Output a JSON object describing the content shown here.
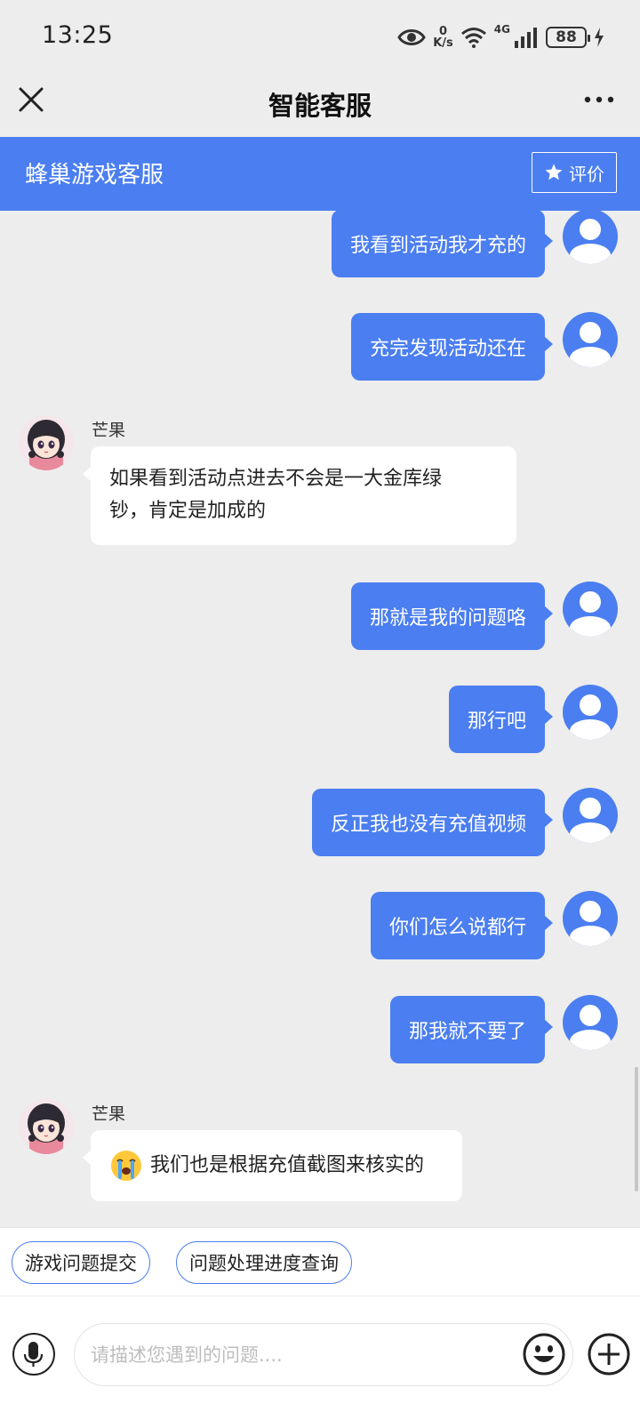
{
  "status_bar": {
    "time": "13:25",
    "net_speed_value": "0",
    "net_speed_unit": "K/s",
    "signal_type": "4G",
    "battery": "88"
  },
  "header": {
    "title": "智能客服",
    "close_icon": "close-icon",
    "more_icon": "more-icon"
  },
  "service_bar": {
    "name": "蜂巢游戏客服",
    "rate_label": "评价",
    "rate_icon": "star-icon"
  },
  "messages": [
    {
      "side": "right",
      "text": "我看到活动我才充的"
    },
    {
      "side": "right",
      "text": "充完发现活动还在"
    },
    {
      "side": "left",
      "sender": "芒果",
      "line1": "如果看到活动点进去不会是一大金库绿",
      "line2": "钞，肯定是加成的"
    },
    {
      "side": "right",
      "text": "那就是我的问题咯"
    },
    {
      "side": "right",
      "text": "那行吧"
    },
    {
      "side": "right",
      "text": "反正我也没有充值视频"
    },
    {
      "side": "right",
      "text": "你们怎么说都行"
    },
    {
      "side": "right",
      "text": "那我就不要了"
    },
    {
      "side": "left",
      "sender": "芒果",
      "emoji": "crying-face-emoji",
      "text": "我们也是根据充值截图来核实的"
    }
  ],
  "quick_actions": [
    {
      "label": "游戏问题提交"
    },
    {
      "label": "问题处理进度查询"
    }
  ],
  "input_bar": {
    "placeholder": "请描述您遇到的问题....",
    "voice_icon": "microphone-icon",
    "emoji_icon": "smiley-icon",
    "plus_icon": "plus-icon"
  },
  "colors": {
    "accent": "#4b7ef0",
    "background": "#ededed",
    "bubble_left": "#ffffff"
  }
}
